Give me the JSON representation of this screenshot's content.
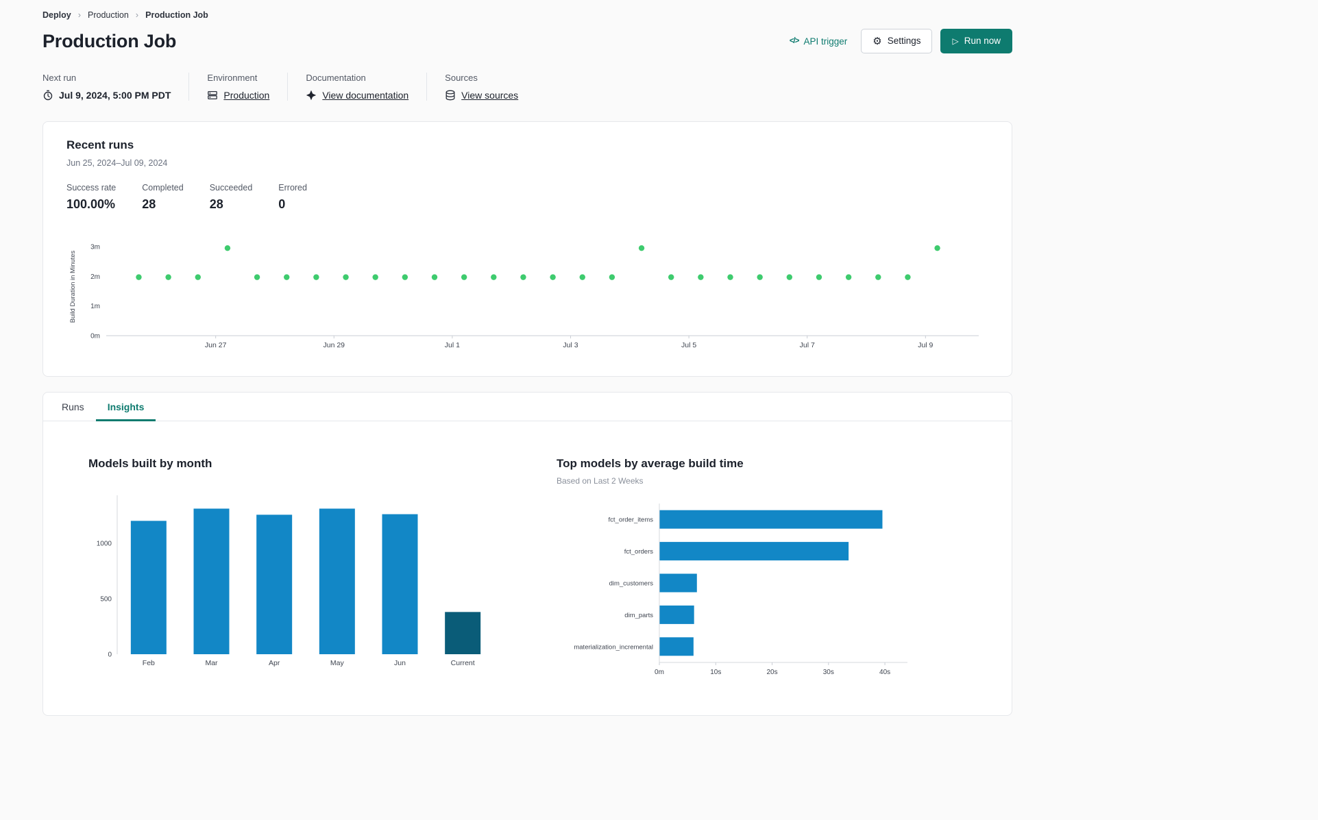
{
  "breadcrumb": {
    "separator": "›",
    "items": [
      {
        "label": "Deploy"
      },
      {
        "label": "Production"
      },
      {
        "label": "Production Job"
      }
    ]
  },
  "header": {
    "title": "Production Job",
    "api_trigger_label": "API trigger",
    "settings_label": "Settings",
    "run_now_label": "Run now"
  },
  "info": {
    "next_run": {
      "label": "Next run",
      "value": "Jul 9, 2024, 5:00 PM PDT",
      "icon": "clock-icon"
    },
    "environment": {
      "label": "Environment",
      "value": "Production",
      "icon": "environment-icon"
    },
    "documentation": {
      "label": "Documentation",
      "value": "View documentation",
      "icon": "dbt-docs-icon"
    },
    "sources": {
      "label": "Sources",
      "value": "View sources",
      "icon": "database-icon"
    }
  },
  "recent_runs": {
    "title": "Recent runs",
    "date_range": "Jun 25, 2024–Jul 09, 2024",
    "stats": [
      {
        "label": "Success rate",
        "value": "100.00%"
      },
      {
        "label": "Completed",
        "value": "28"
      },
      {
        "label": "Succeeded",
        "value": "28"
      },
      {
        "label": "Errored",
        "value": "0"
      }
    ]
  },
  "tabs": [
    {
      "label": "Runs",
      "active": false
    },
    {
      "label": "Insights",
      "active": true
    }
  ],
  "colors": {
    "accent_teal": "#0e7b6f",
    "run_dot_green": "#3ecb6e",
    "bar_blue": "#1287c6",
    "bar_dark_blue": "#0a5c78"
  },
  "chart_data": [
    {
      "type": "scatter",
      "ylabel": "Build Duration in Minutes",
      "y_ticks": [
        "0m",
        "1m",
        "2m",
        "3m"
      ],
      "ylim": [
        0,
        3.3
      ],
      "x_ticks": [
        "Jun 27",
        "Jun 29",
        "Jul 1",
        "Jul 3",
        "Jul 5",
        "Jul 7",
        "Jul 9"
      ],
      "x_tick_positions": [
        2,
        4,
        6,
        8,
        10,
        12,
        14
      ],
      "xlim": [
        0.15,
        14.9
      ],
      "point_color": "#3ecb6e",
      "points": [
        {
          "x": 0.7,
          "y": 1.97
        },
        {
          "x": 1.2,
          "y": 1.97
        },
        {
          "x": 1.7,
          "y": 1.97
        },
        {
          "x": 2.2,
          "y": 2.95
        },
        {
          "x": 2.7,
          "y": 1.97
        },
        {
          "x": 3.2,
          "y": 1.97
        },
        {
          "x": 3.7,
          "y": 1.97
        },
        {
          "x": 4.2,
          "y": 1.97
        },
        {
          "x": 4.7,
          "y": 1.97
        },
        {
          "x": 5.2,
          "y": 1.97
        },
        {
          "x": 5.7,
          "y": 1.97
        },
        {
          "x": 6.2,
          "y": 1.97
        },
        {
          "x": 6.7,
          "y": 1.97
        },
        {
          "x": 7.2,
          "y": 1.97
        },
        {
          "x": 7.7,
          "y": 1.97
        },
        {
          "x": 8.2,
          "y": 1.97
        },
        {
          "x": 8.7,
          "y": 1.97
        },
        {
          "x": 9.2,
          "y": 2.95
        },
        {
          "x": 9.7,
          "y": 1.97
        },
        {
          "x": 10.2,
          "y": 1.97
        },
        {
          "x": 10.7,
          "y": 1.97
        },
        {
          "x": 11.2,
          "y": 1.97
        },
        {
          "x": 11.7,
          "y": 1.97
        },
        {
          "x": 12.2,
          "y": 1.97
        },
        {
          "x": 12.7,
          "y": 1.97
        },
        {
          "x": 13.2,
          "y": 1.97
        },
        {
          "x": 13.7,
          "y": 1.97
        },
        {
          "x": 14.2,
          "y": 2.95
        }
      ]
    },
    {
      "type": "bar",
      "title": "Models built by month",
      "categories": [
        "Feb",
        "Mar",
        "Apr",
        "May",
        "Jun",
        "Current"
      ],
      "values": [
        1200,
        1310,
        1255,
        1310,
        1260,
        380
      ],
      "y_ticks": [
        0,
        500,
        1000
      ],
      "ylim": [
        0,
        1430
      ],
      "bar_color": "#1287c6",
      "highlight_index": 5,
      "highlight_color": "#0a5c78"
    },
    {
      "type": "hbar",
      "title": "Top models by average build time",
      "subtitle": "Based on Last 2 Weeks",
      "categories": [
        "fct_order_items",
        "fct_orders",
        "dim_customers",
        "dim_parts",
        "materialization_incremental"
      ],
      "values": [
        39.5,
        33.5,
        6.6,
        6.1,
        6.0
      ],
      "x_ticks": [
        "0m",
        "10s",
        "20s",
        "30s",
        "40s"
      ],
      "x_tick_values": [
        0,
        10,
        20,
        30,
        40
      ],
      "xlim": [
        0,
        44
      ],
      "bar_color": "#1287c6"
    }
  ]
}
